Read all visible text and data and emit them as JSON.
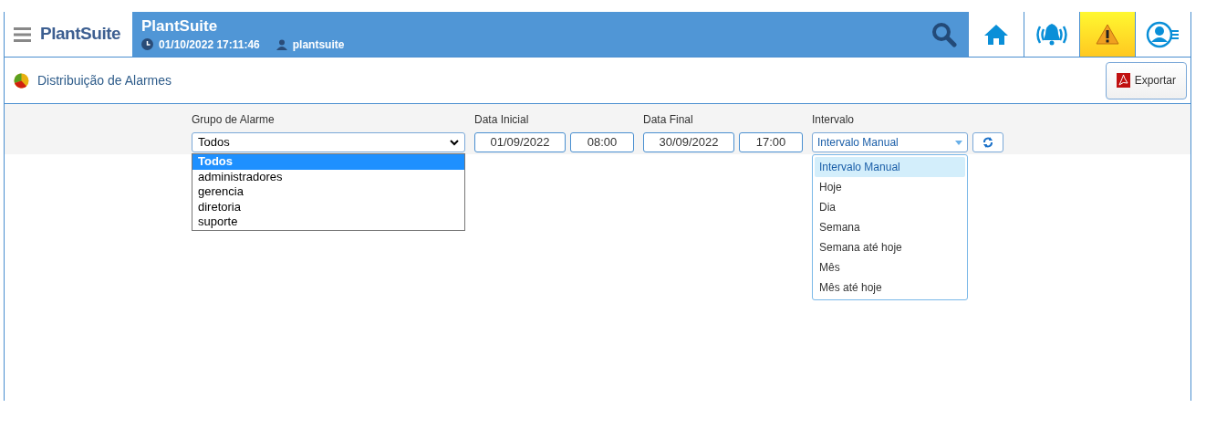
{
  "header": {
    "brand": "PlantSuite",
    "title": "PlantSuite",
    "datetime": "01/10/2022 17:11:46",
    "user": "plantsuite"
  },
  "nav_buttons": [
    {
      "kind": "home",
      "active": false
    },
    {
      "kind": "alarm",
      "active": false
    },
    {
      "kind": "warning",
      "active": true
    },
    {
      "kind": "profile",
      "active": false
    }
  ],
  "page": {
    "title": "Distribuição de Alarmes",
    "export_button": "Exportar"
  },
  "filters": {
    "group": {
      "label": "Grupo de Alarme",
      "value": "Todos",
      "options": [
        {
          "label": "Todos",
          "selected": true
        },
        {
          "label": "administradores",
          "selected": false
        },
        {
          "label": "gerencia",
          "selected": false
        },
        {
          "label": "diretoria",
          "selected": false
        },
        {
          "label": "suporte",
          "selected": false
        }
      ]
    },
    "start": {
      "label": "Data Inicial",
      "date": "01/09/2022",
      "time": "08:00"
    },
    "end": {
      "label": "Data Final",
      "date": "30/09/2022",
      "time": "17:00"
    },
    "interval": {
      "label": "Intervalo",
      "value": "Intervalo Manual",
      "options": [
        {
          "label": "Intervalo Manual",
          "selected": true
        },
        {
          "label": "Hoje",
          "selected": false
        },
        {
          "label": "Dia",
          "selected": false
        },
        {
          "label": "Semana",
          "selected": false
        },
        {
          "label": "Semana até hoje",
          "selected": false
        },
        {
          "label": "Mês",
          "selected": false
        },
        {
          "label": "Mês até hoje",
          "selected": false
        }
      ]
    }
  }
}
